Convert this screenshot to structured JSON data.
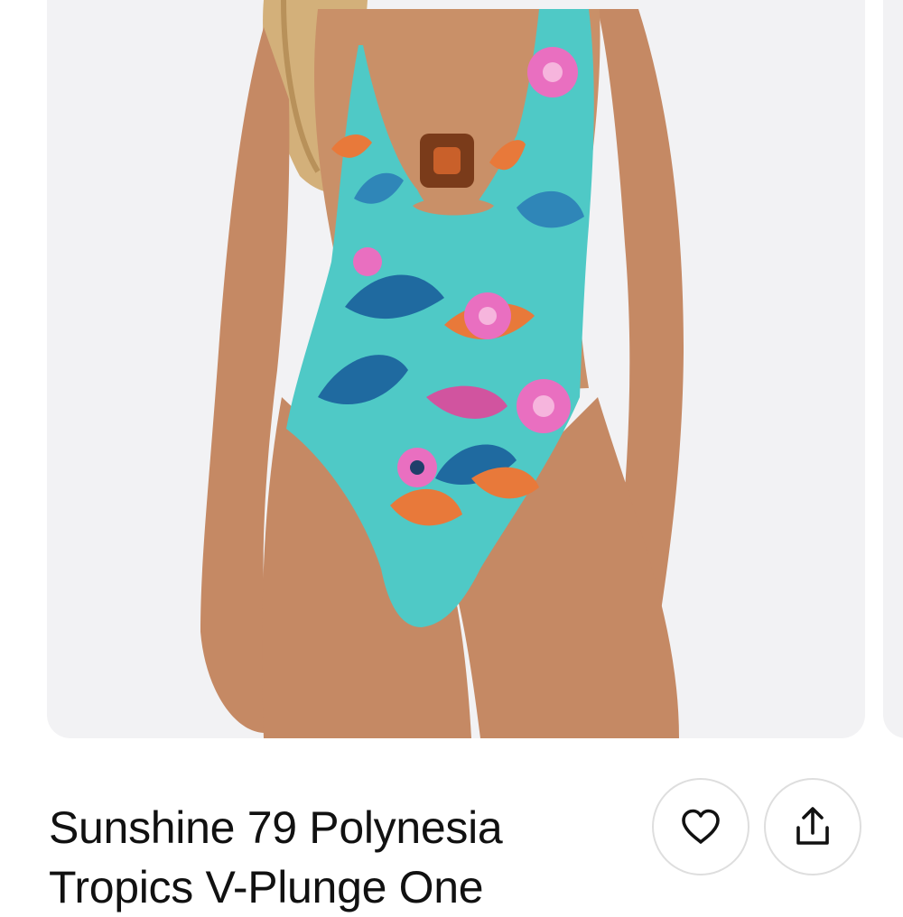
{
  "product": {
    "title": "Sunshine 79 Polynesia Tropics V-Plunge One",
    "image_icon": "product-photo"
  },
  "actions": {
    "favorite_icon": "heart-icon",
    "share_icon": "share-icon"
  },
  "colors": {
    "card_background": "#f2f2f4",
    "swimsuit_base": "#4fc9c6",
    "accent_orange": "#e8793a",
    "accent_pink": "#e96fc0",
    "text": "#111111"
  }
}
